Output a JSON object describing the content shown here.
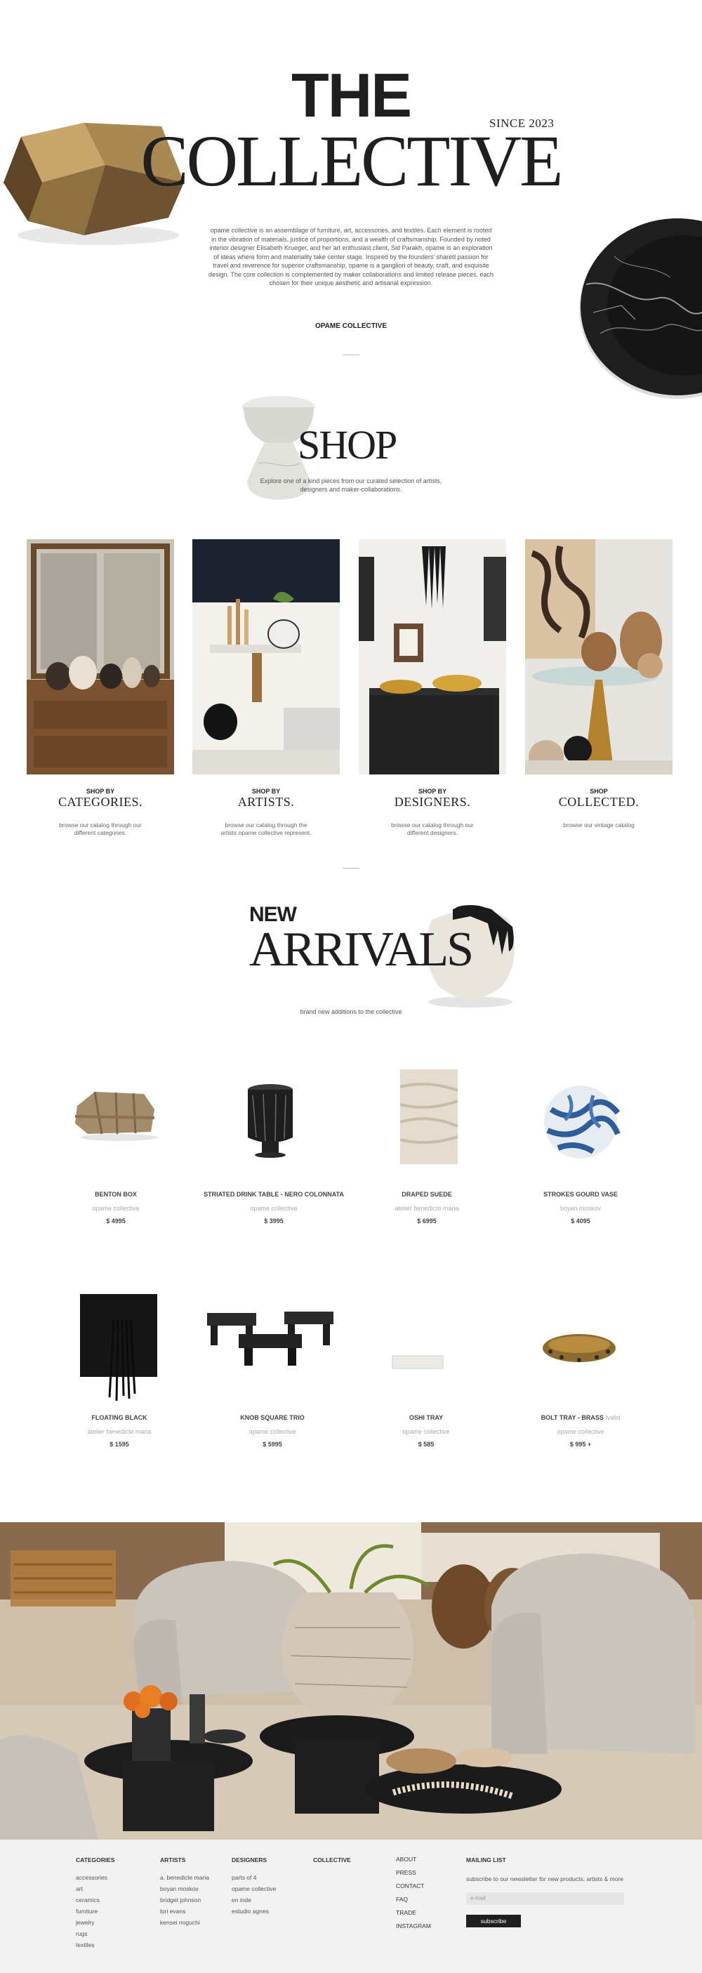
{
  "hero": {
    "the": "THE",
    "collective": "COLLECTIVE",
    "since": "SINCE 2023",
    "intro": "opame collective is an assemblage of furniture, art, accessories, and textiles. Each element is rooted in the vibration of materials, justice of proportions, and a wealth of craftsmanship. Founded by noted interior designer Elisabeth Krueger, and her art enthusiast client, Sid Parakh, opame is an exploration of ideas where form and materiality take center stage. Inspired by the founders' shared passion for travel and reverence for superior craftsmanship, opame is a gangliori of beauty, craft, and exquisite design. The core collection is complemented by maker collaborations and limited release pieces, each chosen for their unique aesthetic and artisanal expression.",
    "link": "OPAME COLLECTIVE"
  },
  "shop": {
    "title": "SHOP",
    "desc": "Explore one of a kind pieces from our curated selection of artists, designers and maker-collaborations.",
    "cards": [
      {
        "kicker": "SHOP BY",
        "title": "CATEGORIES.",
        "desc": "browse our catalog through our different categories."
      },
      {
        "kicker": "SHOP BY",
        "title": "ARTISTS.",
        "desc": "browse our catalog through the artists opame collective represent."
      },
      {
        "kicker": "SHOP BY",
        "title": "DESIGNERS.",
        "desc": "browse our catalog through our different designers."
      },
      {
        "kicker": "SHOP",
        "title": "COLLECTED.",
        "desc": "browse our vintage catalog"
      }
    ]
  },
  "arrivals": {
    "new": "NEW",
    "title": "ARRIVALS",
    "desc": "brand new additions to the collective",
    "products": [
      {
        "name": "BENTON BOX",
        "artist": "opame collective",
        "price": "$ 4995"
      },
      {
        "name": "STRIATED DRINK TABLE - NERO COLONNATA",
        "artist": "opame collective",
        "price": "$ 3995"
      },
      {
        "name": "DRAPED SUEDE",
        "artist": "atelier benedicte maria",
        "price": "$ 6995"
      },
      {
        "name": "STROKES GOURD VASE",
        "artist": "boyan moskov",
        "price": "$ 4095"
      },
      {
        "name": "FLOATING BLACK",
        "artist": "atelier benedicte maria",
        "price": "$ 1595"
      },
      {
        "name": "KNOB SQUARE TRIO",
        "artist": "opame collective",
        "price": "$ 5995"
      },
      {
        "name": "OSHI TRAY",
        "artist": "opame collective",
        "price": "$ 585"
      },
      {
        "name": "BOLT TRAY - BRASS",
        "name_suffix": "Ivalid",
        "artist": "opame collective",
        "price": "$ 995 +"
      }
    ]
  },
  "footer": {
    "categories": {
      "head": "CATEGORIES",
      "items": [
        "accessories",
        "art",
        "ceramics",
        "furniture",
        "jewelry",
        "rugs",
        "textiles"
      ]
    },
    "artists": {
      "head": "ARTISTS",
      "items": [
        "a. benedicte maria",
        "boyan moskov",
        "bridget johnson",
        "lori evans",
        "kensei noguchi"
      ]
    },
    "designers": {
      "head": "DESIGNERS",
      "items": [
        "parts of 4",
        "opame collective",
        "en inde",
        "estudio agnes"
      ]
    },
    "collective": {
      "head": "COLLECTIVE"
    },
    "about": {
      "items": [
        "ABOUT",
        "PRESS",
        "CONTACT",
        "FAQ",
        "TRADE",
        "INSTAGRAM"
      ]
    },
    "mailing": {
      "head": "MAILING LIST",
      "desc": "subscribe to our newsletter for new products, artists & more",
      "placeholder": "e-mail",
      "button": "subscribe"
    }
  }
}
